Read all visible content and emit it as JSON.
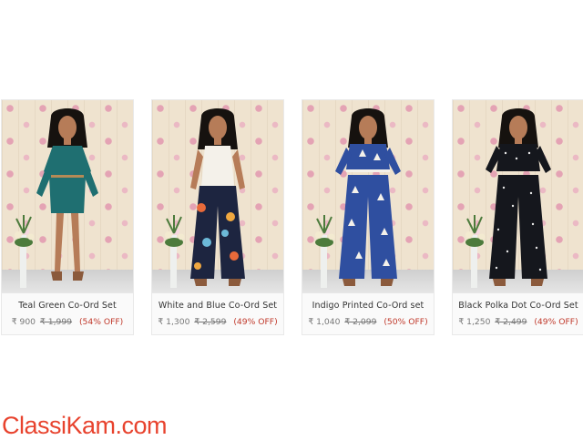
{
  "products": [
    {
      "name": "Teal Green Co-Ord Set",
      "price": "₹ 900",
      "old_price": "₹ 1,999",
      "discount": "(54% OFF)",
      "outfit_color": "#1f6f71",
      "pattern": "solid",
      "style": "romper"
    },
    {
      "name": "White and Blue Co-Ord Set",
      "price": "₹ 1,300",
      "old_price": "₹ 2,599",
      "discount": "(49% OFF)",
      "outfit_color": "#1d2540",
      "pattern": "floral",
      "style": "crop-palazzo"
    },
    {
      "name": "Indigo Printed Co-Ord set",
      "price": "₹ 1,040",
      "old_price": "₹ 2,099",
      "discount": "(50% OFF)",
      "outfit_color": "#2f4fa0",
      "pattern": "print",
      "style": "crop-palazzo"
    },
    {
      "name": "Black Polka Dot Co-Ord Set",
      "price": "₹ 1,250",
      "old_price": "₹ 2,499",
      "discount": "(49% OFF)",
      "outfit_color": "#15171d",
      "pattern": "polka",
      "style": "crop-palazzo"
    }
  ],
  "brand": {
    "logo_text": "ClassiKam.com",
    "color": "#e8432e"
  },
  "colors": {
    "discount": "#c0392b",
    "price": "#777777"
  }
}
